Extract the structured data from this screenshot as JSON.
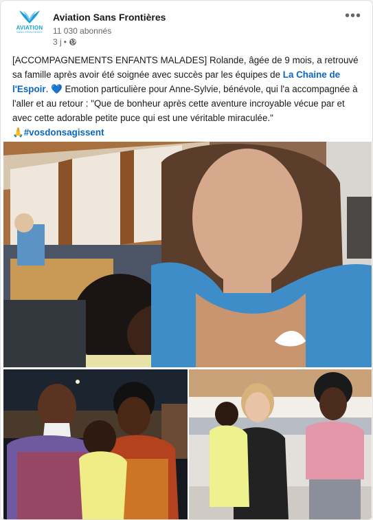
{
  "post": {
    "org_name": "Aviation Sans Frontières",
    "followers": "11 030 abonnés",
    "time": "3 j",
    "separator": "•",
    "more_label": "•••",
    "logo_text": "AVIATION",
    "logo_sub": "SANS FRONTIÈRES",
    "text_part1": "[ACCOMPAGNEMENTS ENFANTS MALADES] Rolande, âgée de 9 mois, a retrouvé sa famille après avoir été soignée avec succès par les équipes de ",
    "link": "La Chaine de l'Espoir",
    "text_part2": ". ",
    "heart": "💙",
    "text_part3": " Emotion particulière pour Anne-Sylvie, bénévole, qui l'a accompagnée à l'aller et au retour : \"Que de bonheur après cette aventure incroyable vécue par et avec cette adorable petite puce qui est une véritable miraculée.\"",
    "pray": "🙏",
    "hashtag": "#vosdonsagissent"
  },
  "colors": {
    "brand": "#1e9ed6",
    "link": "#0a66c2"
  },
  "icons": {
    "more": "more-icon",
    "globe": "globe-icon",
    "logo": "logo-icon"
  }
}
